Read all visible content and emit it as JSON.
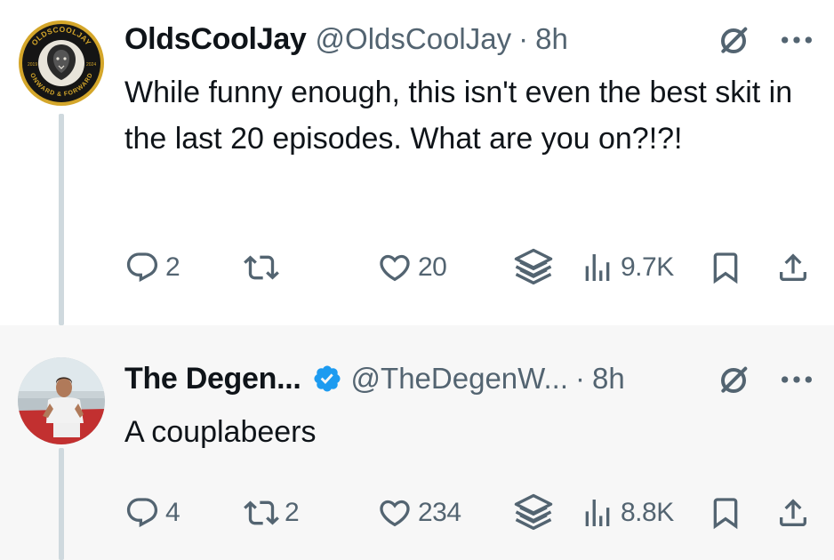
{
  "tweets": [
    {
      "display_name": "OldsCoolJay",
      "handle": "@OldsCoolJay",
      "separator": "·",
      "time": "8h",
      "verified": false,
      "text": "While funny enough, this isn't even the best skit in the last 20 episodes. What are you on?!?!",
      "avatar": {
        "type": "logo",
        "top_text": "OLDSCOOLJAY",
        "bottom_text": "ONWARD & FORWARD",
        "left_text": "2019",
        "right_text": "2024"
      },
      "actions": {
        "reply_count": "2",
        "retweet_count": "",
        "like_count": "20",
        "views_count": "9.7K"
      }
    },
    {
      "display_name": "The Degen...",
      "handle": "@TheDegenW...",
      "separator": "·",
      "time": "8h",
      "verified": true,
      "text": "A couplabeers",
      "avatar": {
        "type": "photo"
      },
      "actions": {
        "reply_count": "4",
        "retweet_count": "2",
        "like_count": "234",
        "views_count": "8.8K"
      }
    }
  ],
  "icons": {
    "reply": "reply-icon",
    "retweet": "retweet-icon",
    "like": "heart-icon",
    "grok": "grok-stack-icon",
    "views": "views-bar-icon",
    "bookmark": "bookmark-icon",
    "share": "share-icon",
    "more": "more-dots-icon",
    "grok_header": "grok-icon",
    "verified": "verified-badge-icon"
  },
  "colors": {
    "text": "#0f1419",
    "secondary": "#536471",
    "verified": "#1d9bf0",
    "thread_line": "#cfd9de",
    "reply_bg": "#f7f7f7"
  }
}
